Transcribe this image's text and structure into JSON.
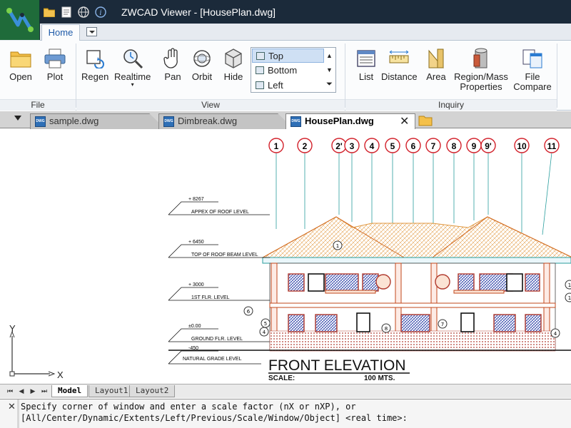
{
  "window": {
    "title": "ZWCAD Viewer - [HousePlan.dwg]"
  },
  "ribbon": {
    "tabs": [
      {
        "label": "Home"
      }
    ],
    "groups": {
      "file": {
        "label": "File",
        "buttons": [
          "Open",
          "Plot"
        ]
      },
      "view": {
        "label": "View",
        "buttons": [
          "Regen",
          "Realtime",
          "Pan",
          "Orbit",
          "Hide"
        ],
        "views": [
          "Top",
          "Bottom",
          "Left"
        ],
        "selected_view": "Top"
      },
      "inquiry": {
        "label": "Inquiry",
        "buttons": [
          "List",
          "Distance",
          "Area",
          "Region/Mass Properties",
          "File Compare"
        ]
      }
    }
  },
  "document_tabs": [
    {
      "label": "sample.dwg",
      "active": false
    },
    {
      "label": "Dimbreak.dwg",
      "active": false
    },
    {
      "label": "HousePlan.dwg",
      "active": true
    }
  ],
  "drawing": {
    "title": "FRONT ELEVATION",
    "scale_label": "SCALE:",
    "scale_value": "100 MTS.",
    "grid_markers": [
      "1",
      "2",
      "2'",
      "3",
      "4",
      "5",
      "6",
      "7",
      "8",
      "9",
      "9'",
      "10",
      "11"
    ],
    "level_marks": [
      {
        "elevation": "+ 8267",
        "label": "APPEX OF ROOF LEVEL"
      },
      {
        "elevation": "+ 6450",
        "label": "TOP OF ROOF BEAM LEVEL"
      },
      {
        "elevation": "+ 3000",
        "label": "1ST FLR. LEVEL"
      },
      {
        "elevation": "±0.00",
        "label": "GROUND FLR. LEVEL"
      },
      {
        "elevation": "-450",
        "label": "NATURAL GRADE LEVEL"
      }
    ],
    "callouts": [
      "1",
      "4",
      "4",
      "5",
      "6",
      "7",
      "8",
      "1",
      "1"
    ],
    "ucs": {
      "x_label": "X",
      "y_label": "Y"
    },
    "colors": {
      "roof": "#e0963c",
      "wall": "#c2471b",
      "window": "#2a3fa8",
      "axis": "#2a9e9e"
    }
  },
  "layout_tabs": [
    "Model",
    "Layout1",
    "Layout2"
  ],
  "command_line": {
    "line1": "Specify corner of window and enter a scale factor (nX or nXP), or",
    "line2": "[All/Center/Dynamic/Extents/Left/Previous/Scale/Window/Object] <real time>:"
  }
}
